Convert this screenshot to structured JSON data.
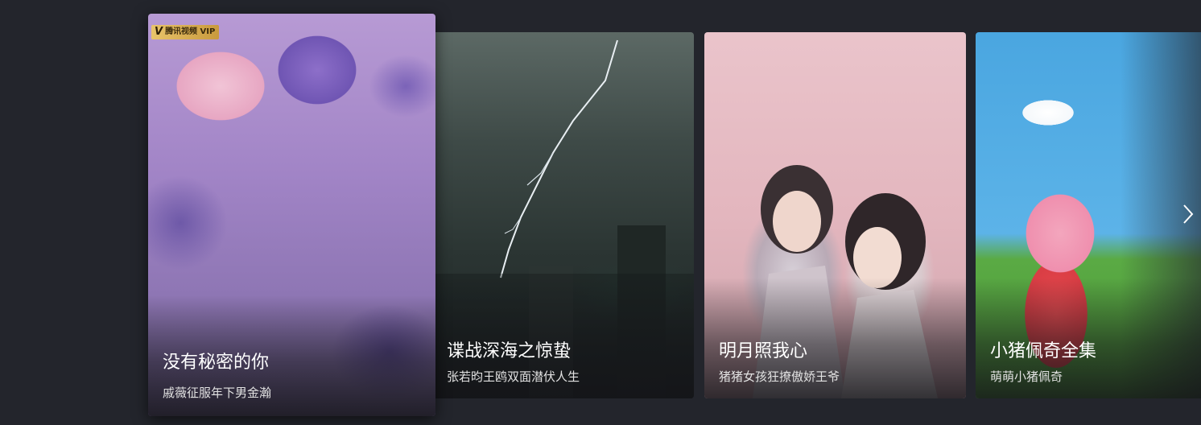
{
  "carousel": {
    "cards": [
      {
        "title": "没有秘密的你",
        "subtitle": "戚薇征服年下男金瀚",
        "badge": "腾讯视频 VIP",
        "badge_mark": "V",
        "active": true
      },
      {
        "title": "谍战深海之惊蛰",
        "subtitle": "张若昀王鸥双面潜伏人生"
      },
      {
        "title": "明月照我心",
        "subtitle": "猪猪女孩狂撩傲娇王爷"
      },
      {
        "title": "小猪佩奇全集",
        "subtitle": "萌萌小猪佩奇"
      }
    ],
    "next_icon": "chevron-right-icon"
  },
  "colors": {
    "background": "#23252c",
    "title_text": "#ffffff",
    "subtitle_text": "#e2e2e2",
    "vip_gold": "#e8c36a"
  }
}
